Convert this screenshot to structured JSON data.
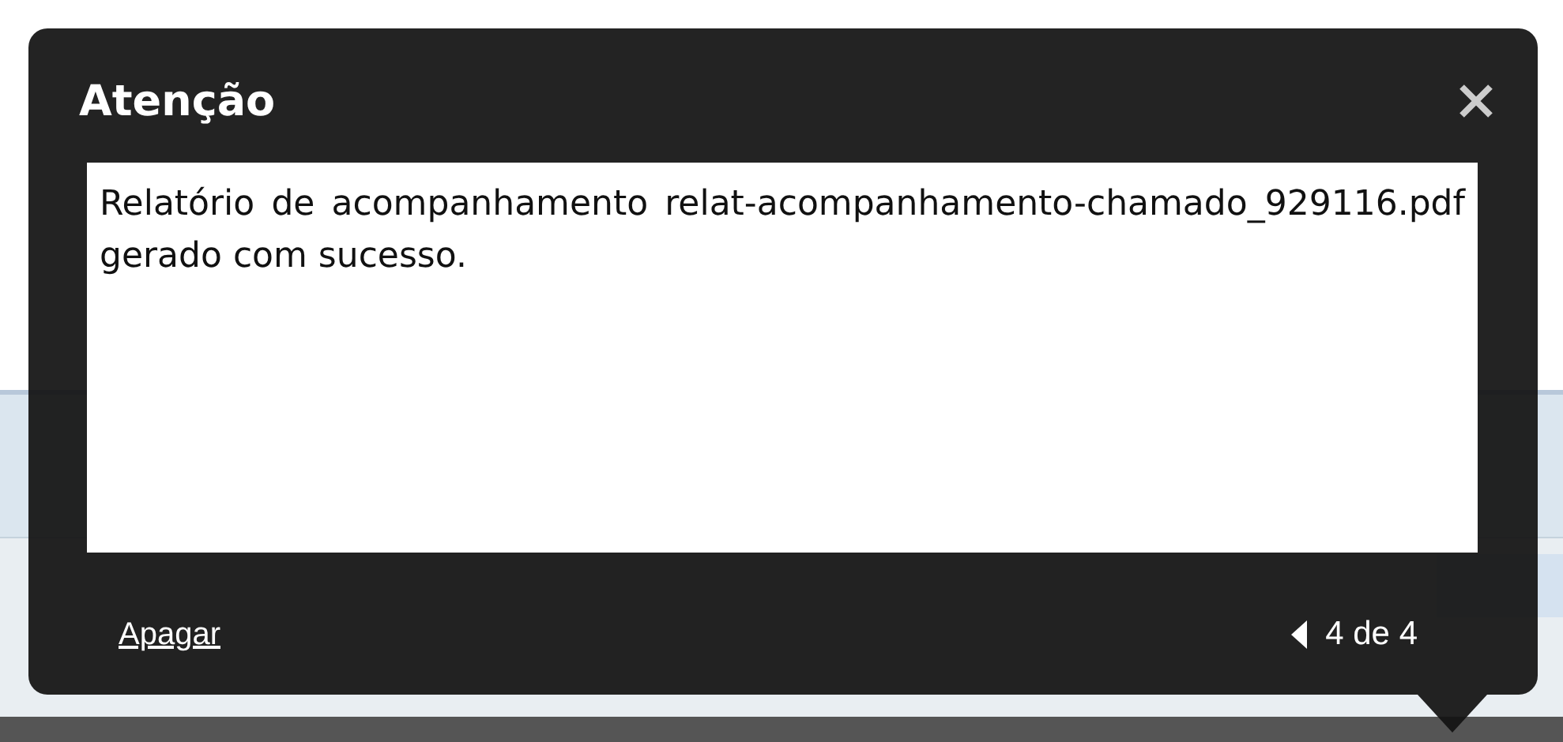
{
  "dialog": {
    "title": "Atenção",
    "message": "Relatório de acompanhamento relat-acompanhamento-chamado_929116.pdf gerado com sucesso.",
    "delete_link": "Apagar",
    "pager": "4 de 4"
  }
}
